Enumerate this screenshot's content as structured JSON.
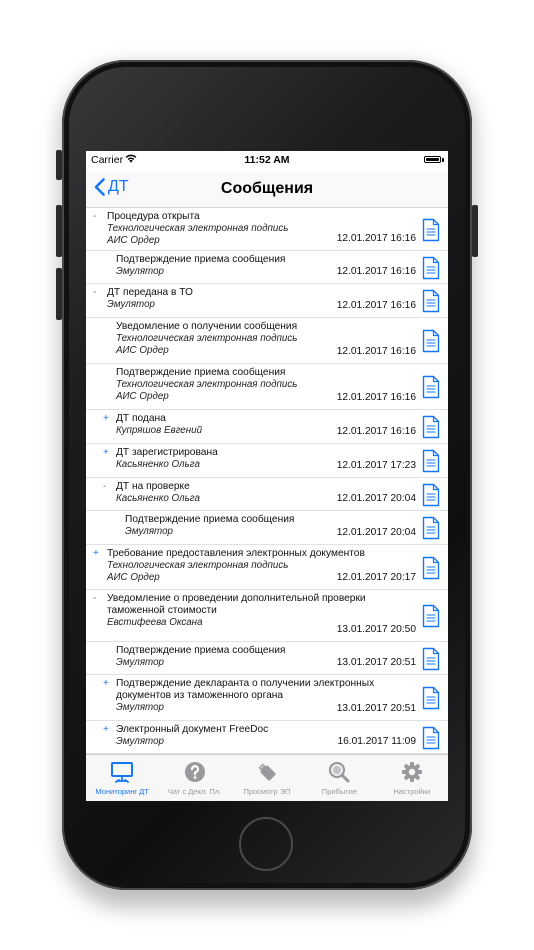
{
  "status_bar": {
    "carrier": "Carrier",
    "time": "11:52 AM"
  },
  "nav": {
    "back_label": "ДТ",
    "title": "Сообщения"
  },
  "messages": [
    {
      "marker": "-",
      "title": "Процедура открыта",
      "subs": [
        "Технологическая электронная подпись",
        "АИС Ордер"
      ],
      "date": "12.01.2017 16:16"
    },
    {
      "marker": "",
      "title": "Подтверждение приема сообщения",
      "subs": [
        "Эмулятор"
      ],
      "date": "12.01.2017 16:16"
    },
    {
      "marker": "-",
      "title": "ДТ передана в ТО",
      "subs": [
        "Эмулятор"
      ],
      "date": "12.01.2017 16:16"
    },
    {
      "marker": "",
      "title": "Уведомление о получении сообщения",
      "subs": [
        "Технологическая электронная подпись",
        "АИС Ордер"
      ],
      "date": "12.01.2017 16:16"
    },
    {
      "marker": "",
      "title": "Подтверждение приема сообщения",
      "subs": [
        "Технологическая электронная подпись",
        "АИС Ордер"
      ],
      "date": "12.01.2017 16:16"
    },
    {
      "marker": "+",
      "title": "ДТ подана",
      "subs": [
        "Купряшов Евгений"
      ],
      "date": "12.01.2017 16:16"
    },
    {
      "marker": "+",
      "title": "ДТ зарегистрирована",
      "subs": [
        "Касьяненко Ольга"
      ],
      "date": "12.01.2017 17:23"
    },
    {
      "marker": "-",
      "title": "ДТ на проверке",
      "subs": [
        "Касьяненко Ольга"
      ],
      "date": "12.01.2017 20:04"
    },
    {
      "marker": "",
      "title": "Подтверждение приема сообщения",
      "subs": [
        "Эмулятор"
      ],
      "date": "12.01.2017 20:04"
    },
    {
      "marker": "+",
      "title": "Требование предоставления электронных документов",
      "subs": [
        "Технологическая электронная подпись",
        "АИС Ордер"
      ],
      "date": "12.01.2017 20:17"
    },
    {
      "marker": "-",
      "title": "Уведомление о проведении дополнительной проверки таможенной стоимости",
      "subs": [
        "Евстифеева Оксана"
      ],
      "date": "13.01.2017 20:50"
    },
    {
      "marker": "",
      "title": "Подтверждение приема сообщения",
      "subs": [
        "Эмулятор"
      ],
      "date": "13.01.2017 20:51"
    },
    {
      "marker": "+",
      "title": "Подтверждение декларанта о получении электронных документов из таможенного органа",
      "subs": [
        "Эмулятор"
      ],
      "date": "13.01.2017 20:51"
    },
    {
      "marker": "+",
      "title": "Электронный документ FreeDoc",
      "subs": [
        "Эмулятор"
      ],
      "date": "16.01.2017 11:09"
    }
  ],
  "tabs": [
    {
      "label": "Мониторинг ДТ",
      "icon": "monitor-icon",
      "active": true
    },
    {
      "label": "Чат с Декл. Пл.",
      "icon": "help-icon",
      "active": false
    },
    {
      "label": "Просмотр ЭП",
      "icon": "usb-drive-icon",
      "active": false
    },
    {
      "label": "Прибытие",
      "icon": "magnifier-icon",
      "active": false
    },
    {
      "label": "Настройки",
      "icon": "gear-icon",
      "active": false
    }
  ],
  "colors": {
    "accent": "#1677f5",
    "inactive": "#9a9a9e"
  }
}
